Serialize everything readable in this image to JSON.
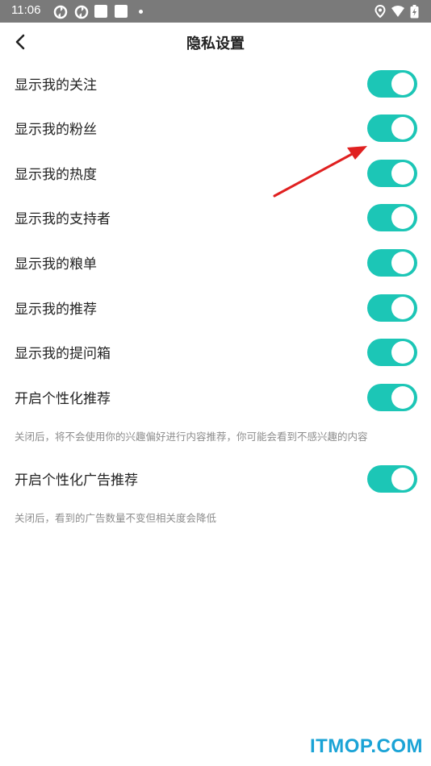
{
  "status_bar": {
    "time": "11:06"
  },
  "header": {
    "title": "隐私设置"
  },
  "settings": [
    {
      "label": "显示我的关注",
      "enabled": true
    },
    {
      "label": "显示我的粉丝",
      "enabled": true
    },
    {
      "label": "显示我的热度",
      "enabled": true
    },
    {
      "label": "显示我的支持者",
      "enabled": true
    },
    {
      "label": "显示我的粮单",
      "enabled": true
    },
    {
      "label": "显示我的推荐",
      "enabled": true
    },
    {
      "label": "显示我的提问箱",
      "enabled": true
    },
    {
      "label": "开启个性化推荐",
      "enabled": true,
      "hint": "关闭后，将不会使用你的兴趣偏好进行内容推荐，你可能会看到不感兴趣的内容"
    },
    {
      "label": "开启个性化广告推荐",
      "enabled": true,
      "hint": "关闭后，看到的广告数量不变但相关度会降低"
    }
  ],
  "colors": {
    "toggle_on": "#1cc6b6",
    "annotation_arrow": "#e02020",
    "status_bar": "#7a7a7a"
  },
  "watermark": {
    "prefix": "IT",
    "rest": "MOP.COM"
  }
}
